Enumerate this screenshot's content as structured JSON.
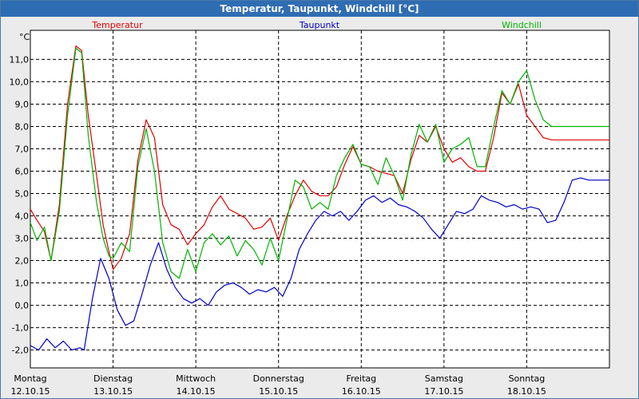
{
  "window": {
    "title": "Temperatur, Taupunkt, Windchill [°C]"
  },
  "chart_data": {
    "type": "line",
    "title": "Temperatur, Taupunkt, Windchill [°C]",
    "ylabel": "°C",
    "ylim": [
      -2.8,
      12.3
    ],
    "xlim": [
      0,
      7
    ],
    "grid": true,
    "legend_position": "top",
    "x_ticks": [
      {
        "x": 0,
        "day": "Montag",
        "date": "12.10.15"
      },
      {
        "x": 1,
        "day": "Dienstag",
        "date": "13.10.15"
      },
      {
        "x": 2,
        "day": "Mittwoch",
        "date": "14.10.15"
      },
      {
        "x": 3,
        "day": "Donnerstag",
        "date": "15.10.15"
      },
      {
        "x": 4,
        "day": "Freitag",
        "date": "16.10.15"
      },
      {
        "x": 5,
        "day": "Samstag",
        "date": "17.10.15"
      },
      {
        "x": 6,
        "day": "Sonntag",
        "date": "18.10.15"
      }
    ],
    "y_ticks": [
      "11,0",
      "10,0",
      "9,0",
      "8,0",
      "7,0",
      "6,0",
      "5,0",
      "4,0",
      "3,0",
      "2,0",
      "1,0",
      "0,0",
      "-1,0",
      "-2,0"
    ],
    "y_tick_values": [
      11,
      10,
      9,
      8,
      7,
      6,
      5,
      4,
      3,
      2,
      1,
      0,
      -1,
      -2
    ],
    "series": [
      {
        "name": "Temperatur",
        "color": "#e00000",
        "x": [
          0,
          0.08,
          0.17,
          0.25,
          0.35,
          0.45,
          0.55,
          0.62,
          0.7,
          0.8,
          0.88,
          0.95,
          1.0,
          1.1,
          1.2,
          1.3,
          1.4,
          1.5,
          1.6,
          1.7,
          1.8,
          1.9,
          2.0,
          2.1,
          2.2,
          2.3,
          2.4,
          2.5,
          2.6,
          2.7,
          2.8,
          2.9,
          3.0,
          3.1,
          3.2,
          3.3,
          3.4,
          3.5,
          3.6,
          3.7,
          3.8,
          3.9,
          4.0,
          4.1,
          4.2,
          4.3,
          4.4,
          4.5,
          4.6,
          4.7,
          4.8,
          4.9,
          5.0,
          5.1,
          5.2,
          5.3,
          5.4,
          5.5,
          5.6,
          5.7,
          5.8,
          5.9,
          6.0,
          6.1,
          6.2,
          6.3,
          6.4,
          6.5,
          6.6,
          6.7,
          6.8,
          6.9,
          7.0
        ],
        "values": [
          4.3,
          3.8,
          3.3,
          2.0,
          4.5,
          9.0,
          11.6,
          11.4,
          8.5,
          5.8,
          3.6,
          2.4,
          1.6,
          2.1,
          3.2,
          6.5,
          8.3,
          7.5,
          4.5,
          3.6,
          3.4,
          2.7,
          3.2,
          3.6,
          4.4,
          4.9,
          4.3,
          4.1,
          3.9,
          3.4,
          3.5,
          3.9,
          2.9,
          4.0,
          4.9,
          5.6,
          5.1,
          4.9,
          4.9,
          5.3,
          6.3,
          7.1,
          6.3,
          6.2,
          6.0,
          5.9,
          5.8,
          5.0,
          6.5,
          7.6,
          7.3,
          8.0,
          7.0,
          6.4,
          6.6,
          6.2,
          6.0,
          6.0,
          7.5,
          9.5,
          9.0,
          9.9,
          8.5,
          8.0,
          7.5,
          7.4,
          7.4,
          7.4,
          7.4,
          7.4,
          7.4,
          7.4,
          7.4
        ]
      },
      {
        "name": "Taupunkt",
        "color": "#0000c8",
        "x": [
          0,
          0.1,
          0.2,
          0.3,
          0.4,
          0.5,
          0.6,
          0.65,
          0.75,
          0.85,
          0.95,
          1.05,
          1.15,
          1.25,
          1.35,
          1.45,
          1.55,
          1.65,
          1.75,
          1.85,
          1.95,
          2.05,
          2.15,
          2.25,
          2.35,
          2.45,
          2.55,
          2.65,
          2.75,
          2.85,
          2.95,
          3.05,
          3.15,
          3.25,
          3.35,
          3.45,
          3.55,
          3.65,
          3.75,
          3.85,
          3.95,
          4.05,
          4.15,
          4.25,
          4.35,
          4.45,
          4.55,
          4.65,
          4.75,
          4.85,
          4.95,
          5.05,
          5.15,
          5.25,
          5.35,
          5.45,
          5.55,
          5.65,
          5.75,
          5.85,
          5.95,
          6.05,
          6.15,
          6.25,
          6.35,
          6.45,
          6.55,
          6.65,
          6.75,
          6.85,
          6.95,
          7.0
        ],
        "values": [
          -1.8,
          -2.0,
          -1.5,
          -1.9,
          -1.6,
          -2.0,
          -1.9,
          -2.0,
          0.3,
          2.1,
          1.2,
          -0.2,
          -0.9,
          -0.7,
          0.5,
          1.8,
          2.8,
          1.6,
          0.8,
          0.3,
          0.1,
          0.3,
          0.0,
          0.6,
          0.9,
          1.0,
          0.8,
          0.5,
          0.7,
          0.6,
          0.8,
          0.4,
          1.2,
          2.5,
          3.2,
          3.8,
          4.2,
          4.0,
          4.2,
          3.8,
          4.2,
          4.7,
          4.9,
          4.6,
          4.8,
          4.5,
          4.4,
          4.2,
          3.9,
          3.4,
          3.0,
          3.6,
          4.2,
          4.1,
          4.3,
          4.9,
          4.7,
          4.6,
          4.4,
          4.5,
          4.3,
          4.4,
          4.3,
          3.7,
          3.8,
          4.6,
          5.6,
          5.7,
          5.6,
          5.6,
          5.6,
          5.6
        ]
      },
      {
        "name": "Windchill",
        "color": "#00b400",
        "x": [
          0,
          0.08,
          0.17,
          0.25,
          0.35,
          0.45,
          0.55,
          0.62,
          0.7,
          0.8,
          0.88,
          0.95,
          1.0,
          1.1,
          1.2,
          1.3,
          1.4,
          1.5,
          1.6,
          1.7,
          1.8,
          1.9,
          2.0,
          2.1,
          2.2,
          2.3,
          2.4,
          2.5,
          2.6,
          2.7,
          2.8,
          2.9,
          3.0,
          3.1,
          3.2,
          3.3,
          3.4,
          3.5,
          3.6,
          3.7,
          3.8,
          3.9,
          4.0,
          4.1,
          4.2,
          4.3,
          4.4,
          4.5,
          4.6,
          4.7,
          4.8,
          4.9,
          5.0,
          5.1,
          5.2,
          5.3,
          5.4,
          5.5,
          5.6,
          5.7,
          5.8,
          5.9,
          6.0,
          6.1,
          6.2,
          6.3,
          6.4,
          6.5,
          6.6,
          6.7,
          6.8,
          6.9,
          7.0
        ],
        "values": [
          3.7,
          2.9,
          3.5,
          2.0,
          4.2,
          8.5,
          11.5,
          11.3,
          7.6,
          4.6,
          3.0,
          2.2,
          2.1,
          2.8,
          2.4,
          6.2,
          7.9,
          6.0,
          2.8,
          1.5,
          1.2,
          2.5,
          1.5,
          2.8,
          3.2,
          2.7,
          3.1,
          2.2,
          2.9,
          2.5,
          1.8,
          3.0,
          2.0,
          3.8,
          5.6,
          5.3,
          4.3,
          4.6,
          4.3,
          5.8,
          6.6,
          7.2,
          6.3,
          6.2,
          5.4,
          6.6,
          5.8,
          4.7,
          6.7,
          8.1,
          7.3,
          8.1,
          6.4,
          7.0,
          7.2,
          7.5,
          6.2,
          6.2,
          8.0,
          9.6,
          9.0,
          10.0,
          10.5,
          9.2,
          8.3,
          8.0,
          8.0,
          8.0,
          8.0,
          8.0,
          8.0,
          8.0,
          8.0
        ]
      }
    ]
  }
}
